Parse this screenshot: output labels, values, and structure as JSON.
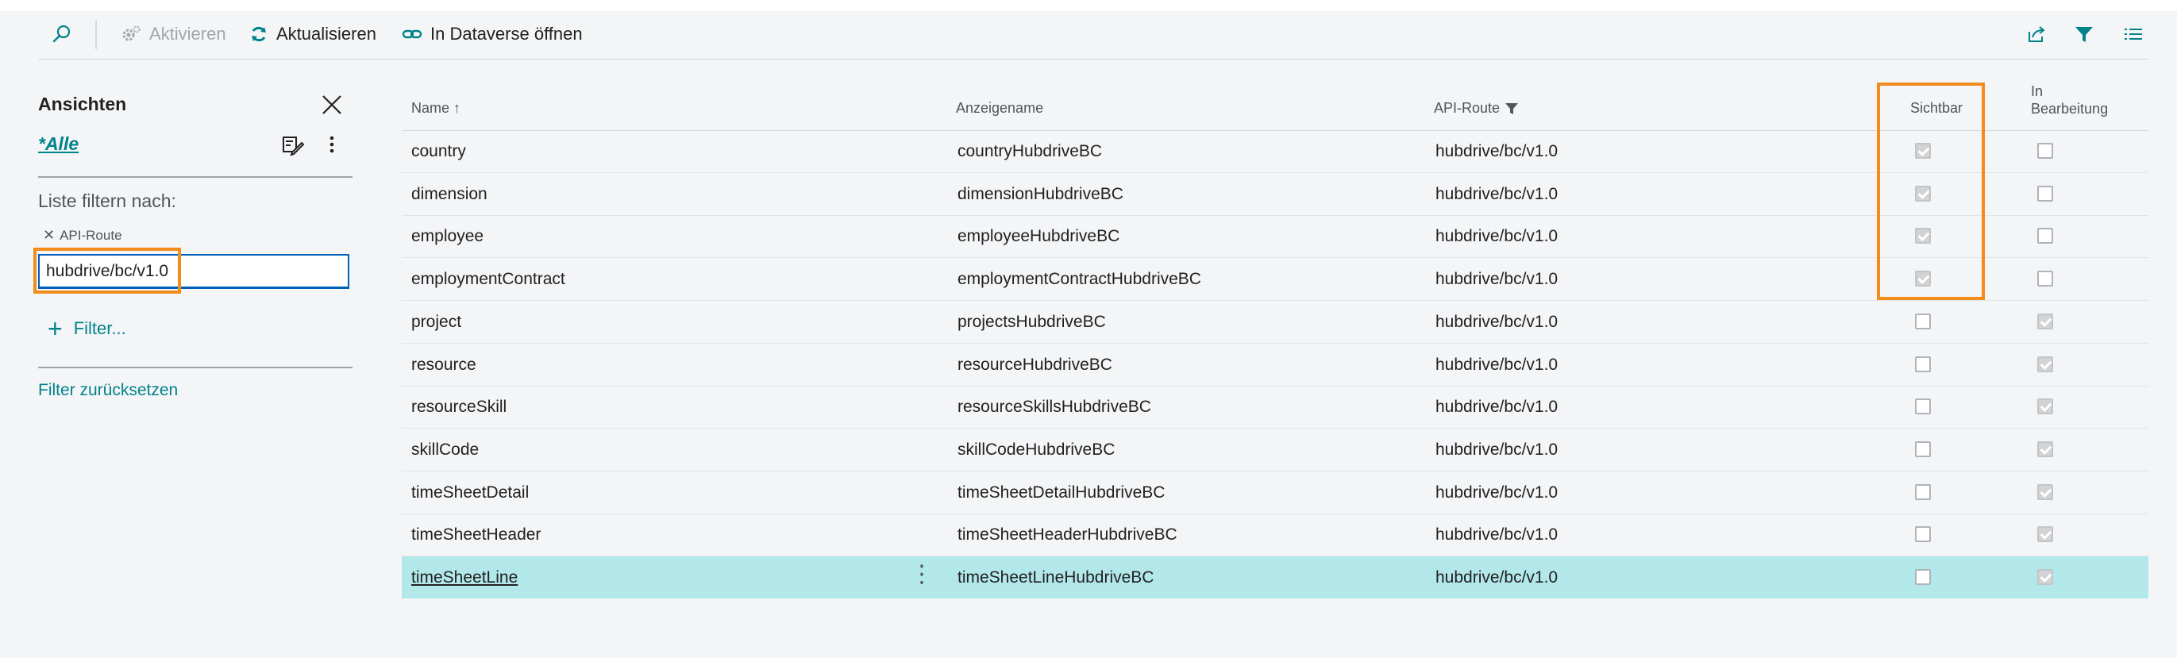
{
  "toolbar": {
    "actions": [
      {
        "label": "Aktivieren",
        "icon": "gear-icon",
        "disabled": true
      },
      {
        "label": "Aktualisieren",
        "icon": "refresh-icon",
        "disabled": false
      },
      {
        "label": "In Dataverse öffnen",
        "icon": "link-icon",
        "disabled": false
      }
    ]
  },
  "pane": {
    "title": "Ansichten",
    "view_label": "*Alle",
    "filter_heading": "Liste filtern nach:",
    "filter_field_label": "API-Route",
    "filter_value": "hubdrive/bc/v1.0",
    "add_filter_label": "Filter...",
    "reset_label": "Filter zurücksetzen"
  },
  "table": {
    "columns": {
      "name": "Name",
      "name_sort": "↑",
      "display": "Anzeigename",
      "route": "API-Route",
      "visible": "Sichtbar",
      "editing_line1": "In",
      "editing_line2": "Bearbeitung"
    },
    "rows": [
      {
        "name": "country",
        "display": "countryHubdriveBC",
        "route": "hubdrive/bc/v1.0",
        "visible": true,
        "editing": false
      },
      {
        "name": "dimension",
        "display": "dimensionHubdriveBC",
        "route": "hubdrive/bc/v1.0",
        "visible": true,
        "editing": false
      },
      {
        "name": "employee",
        "display": "employeeHubdriveBC",
        "route": "hubdrive/bc/v1.0",
        "visible": true,
        "editing": false
      },
      {
        "name": "employmentContract",
        "display": "employmentContractHubdriveBC",
        "route": "hubdrive/bc/v1.0",
        "visible": true,
        "editing": false
      },
      {
        "name": "project",
        "display": "projectsHubdriveBC",
        "route": "hubdrive/bc/v1.0",
        "visible": false,
        "editing": true
      },
      {
        "name": "resource",
        "display": "resourceHubdriveBC",
        "route": "hubdrive/bc/v1.0",
        "visible": false,
        "editing": true
      },
      {
        "name": "resourceSkill",
        "display": "resourceSkillsHubdriveBC",
        "route": "hubdrive/bc/v1.0",
        "visible": false,
        "editing": true
      },
      {
        "name": "skillCode",
        "display": "skillCodeHubdriveBC",
        "route": "hubdrive/bc/v1.0",
        "visible": false,
        "editing": true
      },
      {
        "name": "timeSheetDetail",
        "display": "timeSheetDetailHubdriveBC",
        "route": "hubdrive/bc/v1.0",
        "visible": false,
        "editing": true
      },
      {
        "name": "timeSheetHeader",
        "display": "timeSheetHeaderHubdriveBC",
        "route": "hubdrive/bc/v1.0",
        "visible": false,
        "editing": true
      },
      {
        "name": "timeSheetLine",
        "display": "timeSheetLineHubdriveBC",
        "route": "hubdrive/bc/v1.0",
        "visible": false,
        "editing": true,
        "selected": true
      }
    ]
  },
  "colors": {
    "accent": "#00828a",
    "highlight": "#f28c1c",
    "selected_row": "#b3e8ea",
    "focus_border": "#005fb8"
  }
}
